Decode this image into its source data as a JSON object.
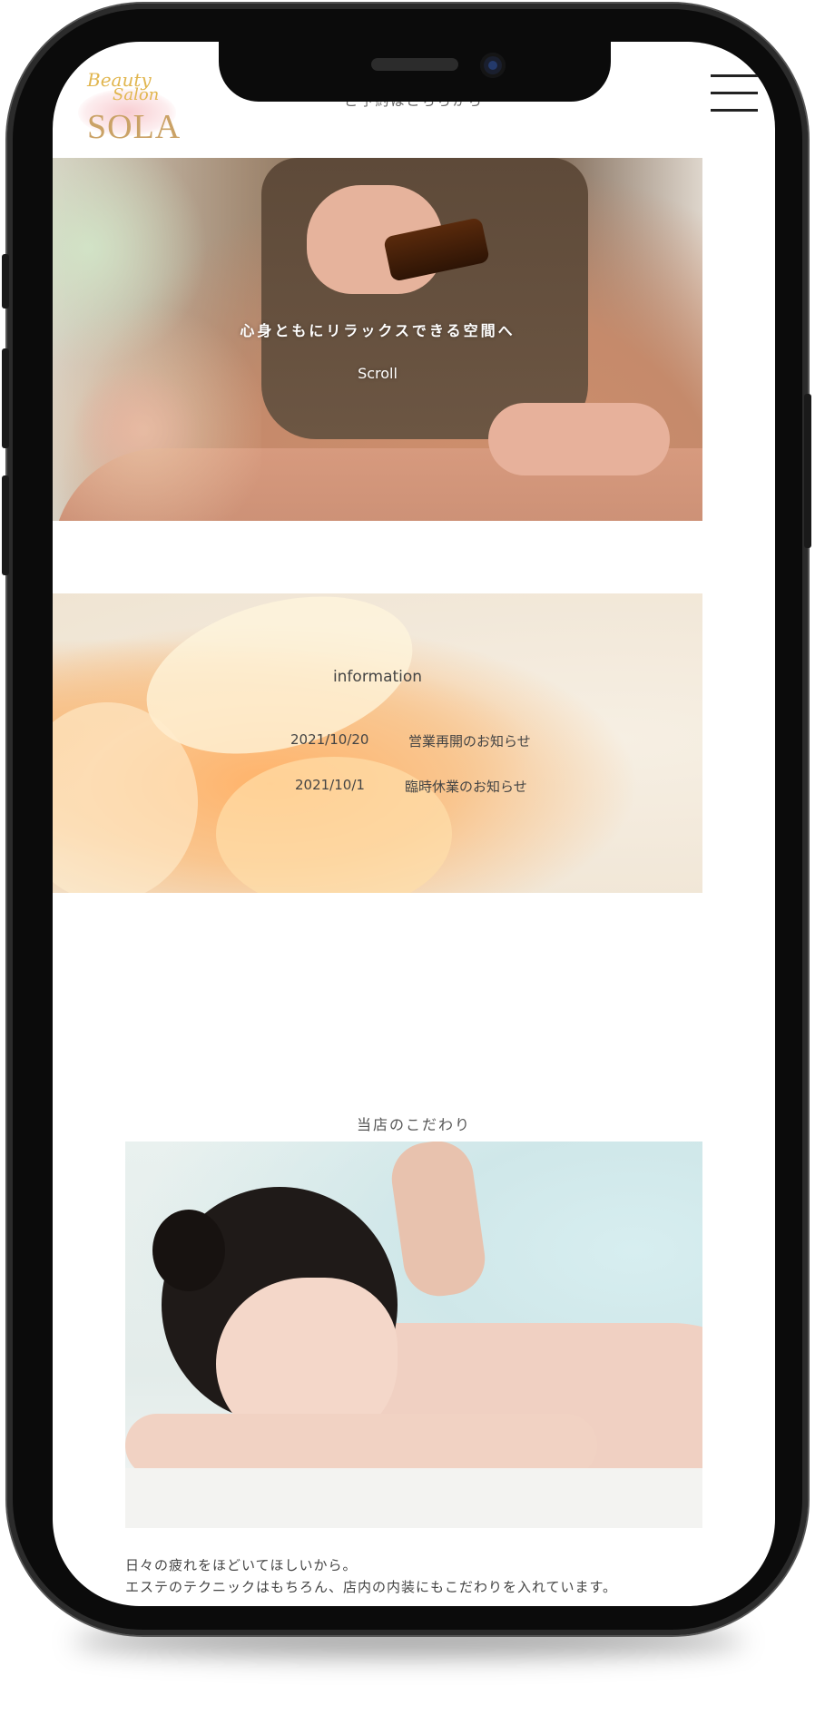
{
  "header": {
    "logo_line1": "Beauty",
    "logo_line2": "Salon",
    "logo_name": "SOLA",
    "reserve_text": "ご予約はこちらから",
    "menu_icon": "hamburger-menu-icon"
  },
  "hero": {
    "tagline": "心身ともにリラックスできる空間へ",
    "scroll_label": "Scroll"
  },
  "information": {
    "title": "information",
    "items": [
      {
        "date": "2021/10/20",
        "text": "営業再開のお知らせ"
      },
      {
        "date": "2021/10/1",
        "text": "臨時休業のお知らせ"
      }
    ]
  },
  "kodawari": {
    "title": "当店のこだわり",
    "line1": "日々の疲れをほどいてほしいから。",
    "line2": "エステのテクニックはもちろん、店内の内装にもこだわりを入れています。"
  }
}
